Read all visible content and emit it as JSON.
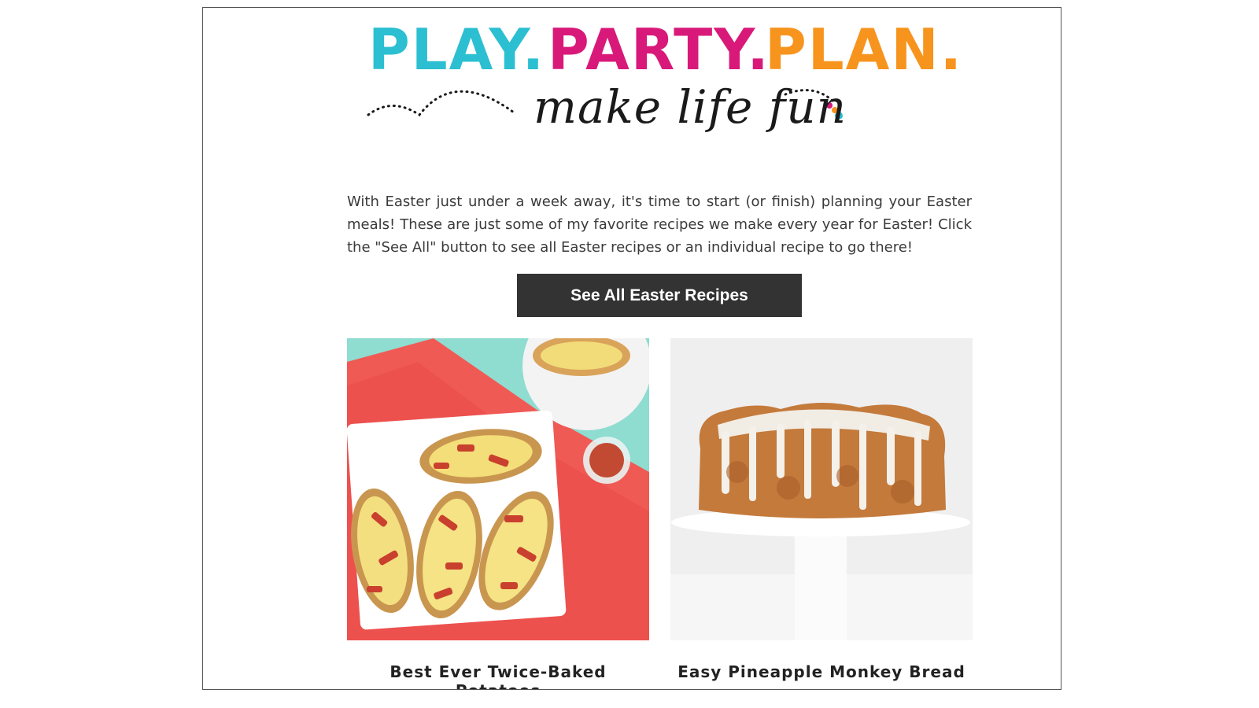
{
  "logo": {
    "word1": "PLAY.",
    "word2": "PARTY.",
    "word3": "PLAN.",
    "tagline": "make life fun",
    "colors": {
      "play": "#2bbfd1",
      "party": "#d8197a",
      "plan": "#f7941d"
    }
  },
  "intro": {
    "text": "With Easter just under a week away, it's time to start (or finish) planning your Easter meals! These are just some of my favorite recipes we make every year for Easter! Click the \"See All\" button to see all Easter recipes or an individual recipe to go there!"
  },
  "cta": {
    "label": "See All Easter Recipes"
  },
  "recipes": [
    {
      "title": "Best Ever Twice-Baked Potatoes"
    },
    {
      "title": "Easy Pineapple Monkey Bread"
    }
  ]
}
